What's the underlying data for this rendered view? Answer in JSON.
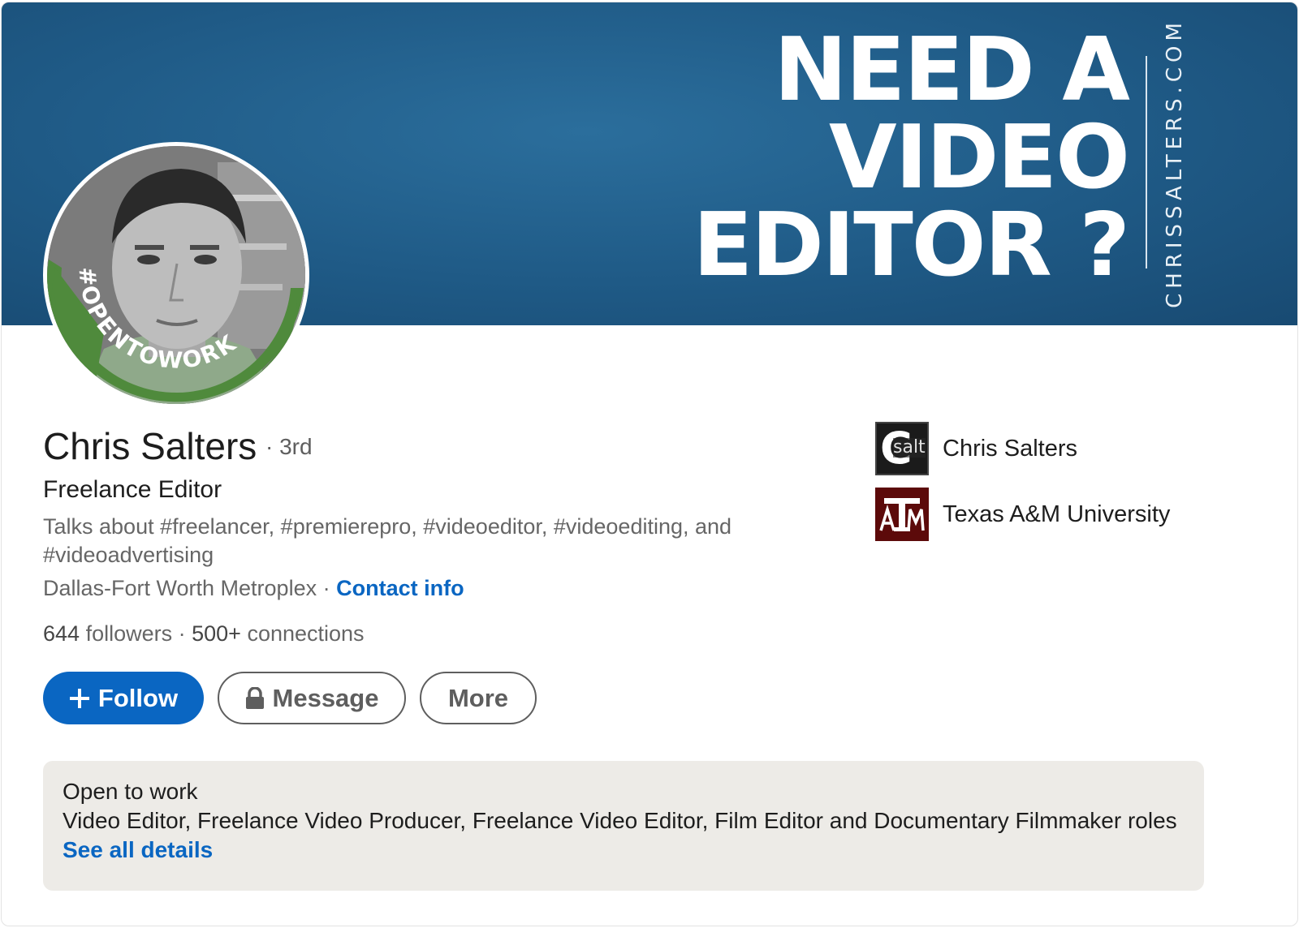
{
  "banner": {
    "headline_lines": [
      "NEED A",
      "VIDEO",
      "EDITOR ?"
    ],
    "vertical_text": "CHRISSALTERS.COM",
    "background_color": "#1f5a86"
  },
  "avatar": {
    "frame_text": "#OPENTOWORK",
    "frame_color": "#4f8a3c"
  },
  "profile": {
    "name": "Chris Salters",
    "degree": "· 3rd",
    "headline": "Freelance Editor",
    "talks_about": "Talks about #freelancer, #premierepro, #videoeditor, #videoediting, and #videoadvertising",
    "location": "Dallas-Fort Worth Metroplex",
    "separator": " · ",
    "contact_info": "Contact info",
    "followers_count": "644",
    "followers_label": " followers",
    "stats_separator": "  · ",
    "connections_count": "500+",
    "connections_label": " connections"
  },
  "actions": {
    "follow_label": "Follow",
    "message_label": "Message",
    "more_label": "More",
    "accent_color": "#0a66c2"
  },
  "entities": [
    {
      "label": "Chris Salters",
      "logo_icon": "salt-logo-icon",
      "logo_text": "salt"
    },
    {
      "label": "Texas A&M University",
      "logo_icon": "tamu-logo-icon"
    }
  ],
  "open_to_work": {
    "title": "Open to work",
    "roles": "Video Editor, Freelance Video Producer, Freelance Video Editor, Film Editor and Documentary Filmmaker roles",
    "link": "See all details"
  }
}
